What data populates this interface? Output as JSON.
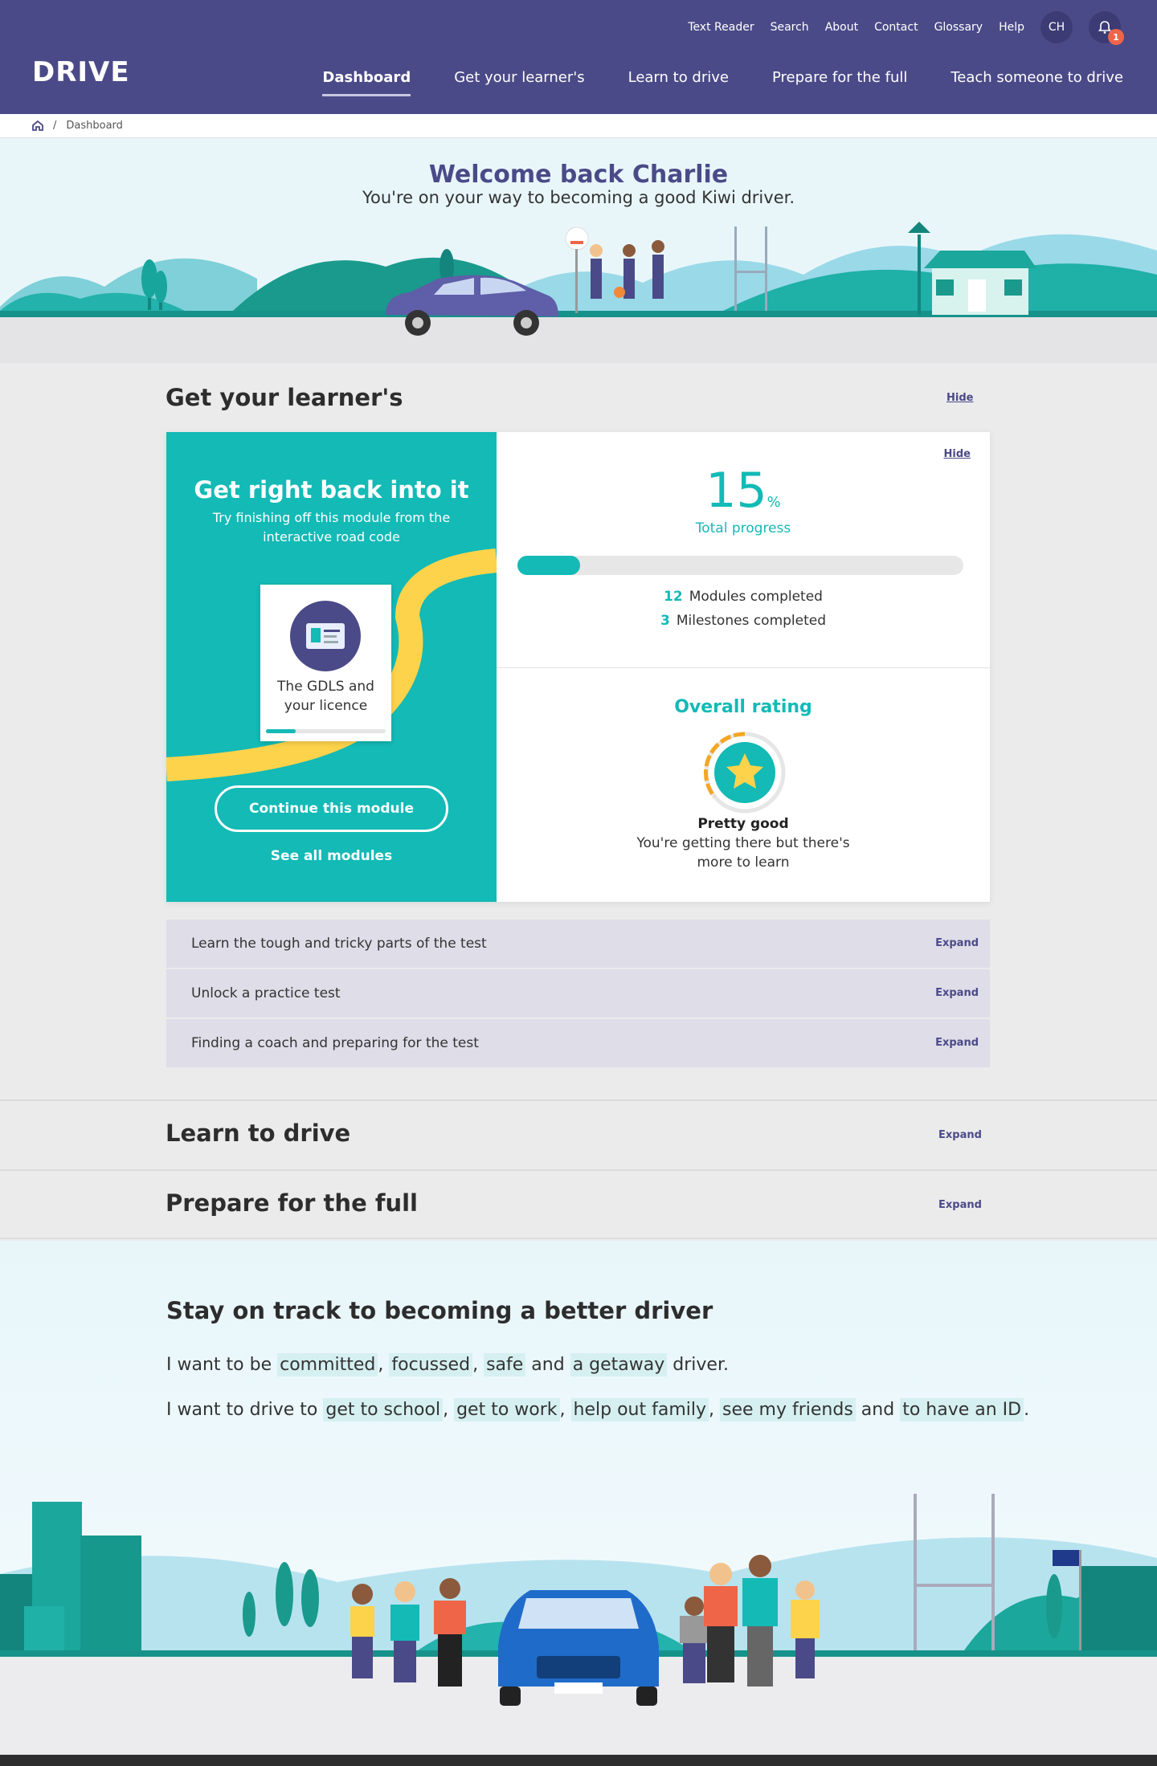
{
  "header": {
    "logo": "DRIVE",
    "utility_links": [
      "Text Reader",
      "Search",
      "About",
      "Contact",
      "Glossary",
      "Help"
    ],
    "avatar_initials": "CH",
    "notification_count": "1",
    "nav": [
      "Dashboard",
      "Get your learner's",
      "Learn to drive",
      "Prepare for the full",
      "Teach someone to drive"
    ]
  },
  "breadcrumb": {
    "separator": "/",
    "current": "Dashboard"
  },
  "hero": {
    "title": "Welcome back Charlie",
    "subtitle": "You're on your way to becoming a good Kiwi driver."
  },
  "learners": {
    "heading": "Get your learner's",
    "hide_label": "Hide",
    "card": {
      "left_title": "Get right back into it",
      "left_subtitle": "Try finishing off this module from the interactive road code",
      "module_name": "The GDLS and your licence",
      "module_progress": 0.25,
      "continue_label": "Continue this module",
      "see_all_label": "See all modules",
      "hide_label": "Hide",
      "progress_value": "15",
      "progress_symbol": "%",
      "progress_fraction": 0.14,
      "progress_label": "Total progress",
      "modules_count": "12",
      "modules_label": "Modules completed",
      "milestones_count": "3",
      "milestones_label": "Milestones completed",
      "rating_title": "Overall rating",
      "rating_word": "Pretty good",
      "rating_desc": "You're getting there but there's more to learn"
    },
    "tasks": [
      {
        "label": "Learn the tough and tricky parts of the test",
        "action": "Expand"
      },
      {
        "label": "Unlock a practice test",
        "action": "Expand"
      },
      {
        "label": "Finding a coach and preparing for the test",
        "action": "Expand"
      }
    ]
  },
  "sections": [
    {
      "heading": "Learn to drive",
      "action": "Expand"
    },
    {
      "heading": "Prepare for the full",
      "action": "Expand"
    }
  ],
  "on_track": {
    "title": "Stay on track to becoming a better driver",
    "line1_prefix": "I want to be",
    "traits": [
      "committed",
      "focussed",
      "safe",
      "a getaway"
    ],
    "line1_and": "and",
    "line1_suffix": "driver.",
    "line2_prefix": "I want to drive to",
    "goals": [
      "get to school",
      "get to work",
      "help out family",
      "see my friends",
      "to have an ID"
    ],
    "line2_and": "and",
    "line2_suffix": "."
  },
  "colors": {
    "brand": "#4b4a88",
    "teal": "#13bab6",
    "accent_yellow": "#fdd34b",
    "badge": "#ef6548"
  }
}
